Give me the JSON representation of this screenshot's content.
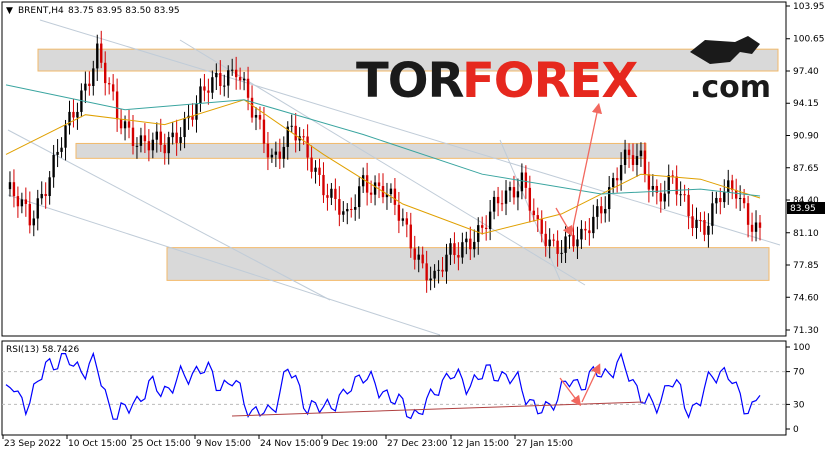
{
  "chart_data": [
    {
      "type": "candlestick",
      "symbol_header": "BRENT,H4",
      "ohlc_header": "83.75 83.95 83.50 83.95",
      "ylim": [
        71.3,
        103.95
      ],
      "y_ticks": [
        "103.95",
        "100.65",
        "97.40",
        "94.15",
        "90.90",
        "87.65",
        "84.40",
        "81.10",
        "77.85",
        "74.60",
        "71.30"
      ],
      "last_price": "83.95",
      "x_tick_labels": [
        "23 Sep 2022",
        "10 Oct 15:00",
        "25 Oct 15:00",
        "9 Nov 15:00",
        "24 Nov 15:00",
        "9 Dec 19:00",
        "27 Dec 23:00",
        "12 Jan 15:00",
        "27 Jan 15:00"
      ],
      "path_points": [
        [
          0,
          85.5
        ],
        [
          6,
          82.5
        ],
        [
          12,
          88
        ],
        [
          18,
          94
        ],
        [
          23,
          99.5
        ],
        [
          28,
          92.5
        ],
        [
          34,
          90.5
        ],
        [
          40,
          89.5
        ],
        [
          46,
          93
        ],
        [
          52,
          96
        ],
        [
          58,
          98
        ],
        [
          62,
          93
        ],
        [
          67,
          88.8
        ],
        [
          72,
          91.5
        ],
        [
          77,
          88
        ],
        [
          82,
          85
        ],
        [
          86,
          82
        ],
        [
          90,
          86.5
        ],
        [
          95,
          85.5
        ],
        [
          100,
          82
        ],
        [
          105,
          78
        ],
        [
          108,
          76
        ],
        [
          112,
          79
        ],
        [
          116,
          80.5
        ],
        [
          120,
          81
        ],
        [
          125,
          85
        ],
        [
          130,
          86.5
        ],
        [
          134,
          81
        ],
        [
          138,
          80
        ],
        [
          142,
          80.5
        ],
        [
          145,
          80
        ],
        [
          150,
          84
        ],
        [
          155,
          88
        ],
        [
          160,
          88.5
        ],
        [
          164,
          85
        ],
        [
          168,
          86
        ],
        [
          172,
          83
        ],
        [
          176,
          82
        ],
        [
          180,
          84.5
        ],
        [
          184,
          85.5
        ],
        [
          187,
          83
        ],
        [
          190,
          81
        ]
      ],
      "sma_fast": [
        [
          0,
          89
        ],
        [
          20,
          93
        ],
        [
          40,
          92
        ],
        [
          60,
          94.5
        ],
        [
          80,
          89
        ],
        [
          100,
          84
        ],
        [
          120,
          81
        ],
        [
          140,
          83
        ],
        [
          160,
          87
        ],
        [
          175,
          86.5
        ],
        [
          190,
          84.6
        ]
      ],
      "sma_slow": [
        [
          0,
          96
        ],
        [
          30,
          93.5
        ],
        [
          60,
          94.5
        ],
        [
          90,
          91
        ],
        [
          120,
          87
        ],
        [
          150,
          85
        ],
        [
          175,
          85.5
        ],
        [
          190,
          84.8
        ]
      ],
      "zones": [
        {
          "low": 97.4,
          "high": 99.6
        },
        {
          "low": 88.6,
          "high": 90.1
        },
        {
          "low": 76.3,
          "high": 79.6
        }
      ]
    },
    {
      "type": "line",
      "header": "RSI(13) 58.7426",
      "ylim": [
        0,
        100
      ],
      "y_ticks": [
        "100",
        "70",
        "30",
        "0"
      ],
      "levels": [
        70,
        30
      ],
      "series_color": "#0000ff"
    }
  ],
  "logo": "TORFOREX.com",
  "colors": {
    "candle_up": "#000000",
    "candle_down": "#d40000",
    "zone_fill": "#d9d9d9",
    "zone_border": "#f2b96a",
    "arrow": "#f2685f",
    "trend_line": "#c0ccd8",
    "sma_fast": "#e0a000",
    "sma_slow": "#3aa5a0",
    "rsi_line": "#0000ff",
    "rsi_trend": "#b04040"
  }
}
